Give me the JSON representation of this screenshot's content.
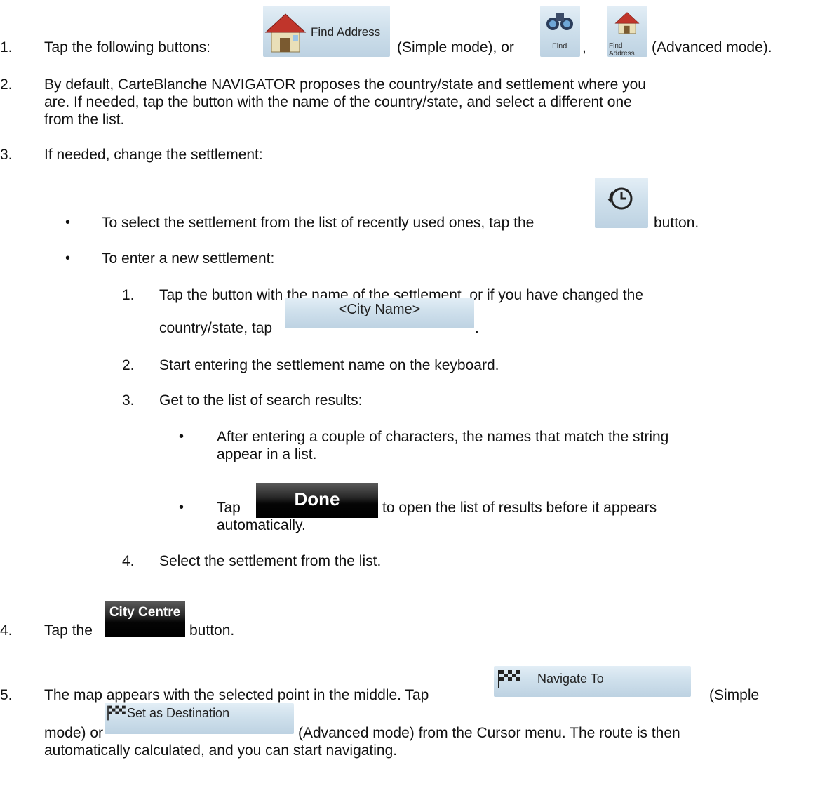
{
  "step1": {
    "num": "1.",
    "text_before": "Tap the following buttons:",
    "btn_find_address": "Find Address",
    "text_middle": "(Simple mode), or",
    "btn_find": "Find",
    "comma": ",",
    "btn_find_address_small": "Find Address",
    "text_after": "(Advanced mode)."
  },
  "step2": {
    "num": "2.",
    "line1": "By default, CarteBlanche NAVIGATOR proposes the country/state and settlement where you",
    "line2": "are. If needed, tap the button with the name of the country/state, and select a different one",
    "line3": "from the list."
  },
  "step3": {
    "num": "3.",
    "text": "If needed, change the settlement:",
    "bullet1": {
      "text_before": "To select the settlement from the list of recently used ones, tap the",
      "text_after": "button."
    },
    "bullet2": {
      "text": "To enter a new settlement:",
      "sub1": {
        "num": "1.",
        "line1": "Tap the button with the name of the settlement, or if you have changed the",
        "line2": "country/state, tap",
        "btn_city_name": "<City Name>",
        "period": "."
      },
      "sub2": {
        "num": "2.",
        "text": "Start entering the settlement name on the keyboard."
      },
      "sub3": {
        "num": "3.",
        "text": "Get to the list of search results:",
        "b1": {
          "line1": "After entering a couple of characters, the names that match the string",
          "line2": "appear in a list."
        },
        "b2": {
          "text_before": "Tap",
          "btn_done": "Done",
          "text_after": "to open the list of results before it appears",
          "line2": "automatically."
        }
      },
      "sub4": {
        "num": "4.",
        "text": "Select the settlement from the list."
      }
    }
  },
  "step4": {
    "num": "4.",
    "text_before": "Tap the",
    "btn_city_centre": "City Centre",
    "text_after": "button."
  },
  "step5": {
    "num": "5.",
    "line1_before": "The map appears with the selected point in the middle. Tap",
    "btn_navigate_to": "Navigate To",
    "line1_after": "(Simple",
    "line2_before": "mode) or",
    "btn_set_dest": "Set as Destination",
    "line2_after": "(Advanced mode) from the Cursor menu. The route is then",
    "line3": "automatically calculated, and you can start navigating."
  },
  "bullet_char": "•"
}
